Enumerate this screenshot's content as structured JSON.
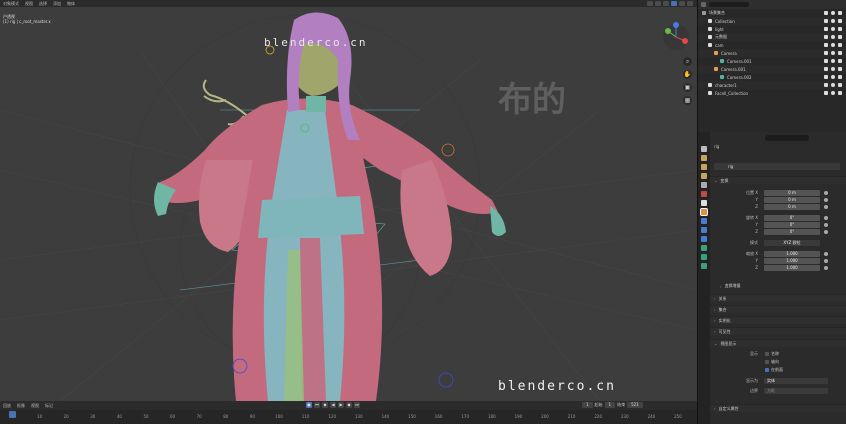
{
  "viewport": {
    "header_items": [
      "对象模式",
      "视图",
      "选择",
      "添加",
      "物体"
    ],
    "info_line1": "户透视",
    "info_line2": "(1) rig | c_root_master.x",
    "watermark_top": "blenderco.cn",
    "watermark_bottom": "blenderco.cn",
    "watermark_cn": "布的"
  },
  "timeline": {
    "menu": [
      "回放",
      "抠像",
      "视图",
      "标记"
    ],
    "current_frame": "1",
    "start_label": "起始",
    "start": "1",
    "end_label": "结束",
    "end": "521",
    "ticks": [
      "0",
      "10",
      "20",
      "30",
      "40",
      "50",
      "60",
      "70",
      "80",
      "90",
      "100",
      "110",
      "120",
      "130",
      "140",
      "150",
      "160",
      "170",
      "180",
      "190",
      "200",
      "210",
      "220",
      "230",
      "240",
      "250"
    ]
  },
  "outliner": {
    "title": "场景集合",
    "rows": [
      {
        "label": "场景集合",
        "indent": 0,
        "color": "#9a9a9a"
      },
      {
        "label": "Collection",
        "indent": 1,
        "color": "#dcdcdc"
      },
      {
        "label": "light",
        "indent": 1,
        "color": "#dcdcdc"
      },
      {
        "label": "元数据",
        "indent": 1,
        "color": "#dcdcdc"
      },
      {
        "label": "cam",
        "indent": 1,
        "color": "#dcdcdc"
      },
      {
        "label": "Camera",
        "indent": 2,
        "color": "#e0a050"
      },
      {
        "label": "Camera.001",
        "indent": 3,
        "color": "#58b0a0"
      },
      {
        "label": "Camera.001",
        "indent": 2,
        "color": "#e0a050"
      },
      {
        "label": "Camera.002",
        "indent": 3,
        "color": "#58b0a0"
      },
      {
        "label": "character1",
        "indent": 1,
        "color": "#dcdcdc"
      },
      {
        "label": "Facell_Collection",
        "indent": 1,
        "color": "#dcdcdc"
      }
    ]
  },
  "properties": {
    "object_name": "rig",
    "field_value": "rig",
    "transform_header": "变换",
    "location_label": "位置 X",
    "location": [
      "0 m",
      "0 m",
      "0 m"
    ],
    "rotation_label": "旋转 X",
    "rotation": [
      "0°",
      "0°",
      "0°"
    ],
    "mode_label": "模式",
    "mode_value": "XYZ 欧拉",
    "scale_label": "缩放 X",
    "scale": [
      "1.000",
      "1.000",
      "1.000"
    ],
    "axis_y": "Y",
    "axis_z": "Z",
    "delta_header": "变换增量",
    "relations": "关系",
    "collections": "集合",
    "instancing": "实例化",
    "visibility": "可见性",
    "viewport_display": "视图显示",
    "show_label": "显示",
    "show_name": "名称",
    "show_axes": "轴向",
    "in_front": "在前面",
    "display_as_label": "显示为",
    "display_as": "实体",
    "bounds_label": "边界",
    "bounds_value": "方框",
    "custom_props": "自定义属性"
  },
  "colors": {
    "accent": "#4772b3",
    "robe": "#c46a7e",
    "robe_inner": "#86b4bf",
    "skin": "#6fb7a4",
    "hair": "#b27fc0"
  }
}
